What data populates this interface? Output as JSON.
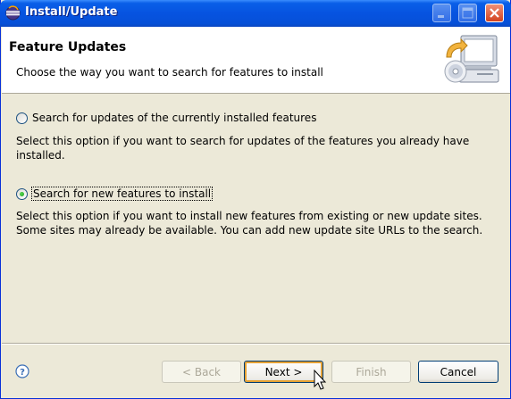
{
  "window": {
    "title": "Install/Update"
  },
  "banner": {
    "title": "Feature Updates",
    "description": "Choose the way you want to search for features to install",
    "icon": "install-wizard-icon"
  },
  "options": [
    {
      "label": "Search for updates of the currently installed features",
      "checked": false,
      "description_lines": [
        "Select this option if you want to search for updates of the features you already have",
        "installed."
      ]
    },
    {
      "label": "Search for new features to install",
      "checked": true,
      "description_lines": [
        "Select this option if you want to install new features from existing or new update sites.",
        "Some sites may already be available. You can add new update site URLs to the search."
      ]
    }
  ],
  "buttons": {
    "back": "< Back",
    "next": "Next >",
    "finish": "Finish",
    "cancel": "Cancel"
  },
  "colors": {
    "title_bar": "#0653e0",
    "dialog_bg": "#ece9d8",
    "radio_dot": "#21a121"
  }
}
